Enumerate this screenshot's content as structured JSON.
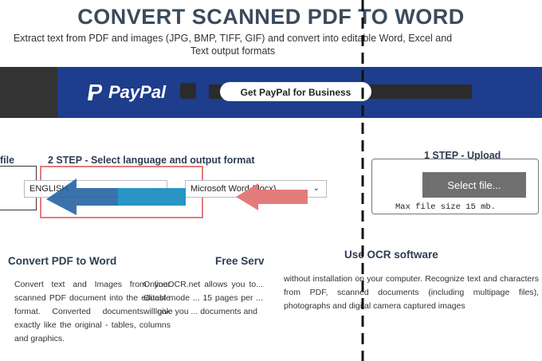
{
  "header": {
    "title": "CONVERT SCANNED PDF TO WORD",
    "subtitle": "Extract text from PDF and images (JPG, BMP, TIFF, GIF) and convert into editable Word, Excel and Text output formats"
  },
  "banner": {
    "logo_text": "PayPal",
    "button_label": "Get PayPal for Business",
    "color": "#1e3d8c"
  },
  "steps": {
    "partial_left": "file",
    "step2_label": "2 STEP - Select language and output format",
    "step1_label": "1 STEP - Upload",
    "language_value": "ENGLISH",
    "format_value": "Microsoft Word (docx)",
    "select_file_label": "Select file...",
    "max_size": "Max file size 15 mb."
  },
  "sections": {
    "convert_heading": "Convert PDF to Word",
    "free_heading": "Free Serv",
    "ocr_heading": "Use OCR software",
    "col1": "Convert text and Images from your scanned PDF document into the editable format. Converted documents look exactly like the original - tables, columns and graphics.",
    "col2": "OnlineOCR.net allows you to... Guest mode ... 15 pages per ... will give you ... documents and",
    "col3": "without installation on your computer. Recognize text and characters from PDF, scanned documents (including multipage files), photographs and digital camera captured images"
  },
  "colors": {
    "accent_red": "#e47b7b",
    "accent_blue": "#1f5fa0"
  }
}
